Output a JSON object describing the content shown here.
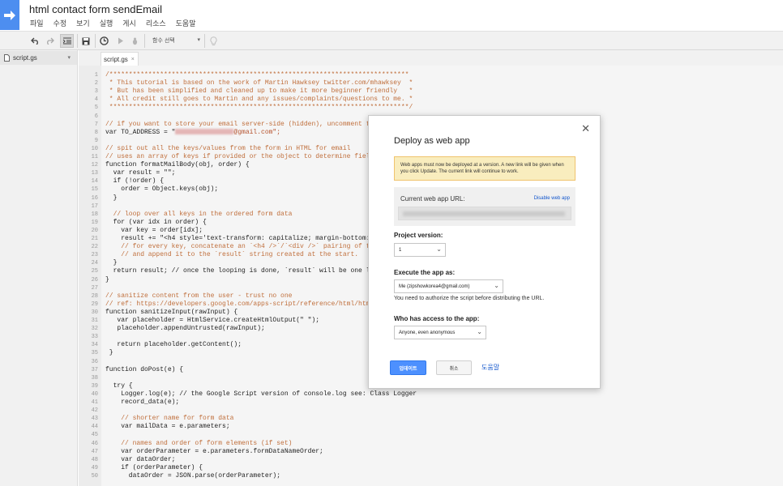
{
  "app": {
    "title": "html contact form sendEmail",
    "menu": [
      "파일",
      "수정",
      "보기",
      "실행",
      "게시",
      "리소스",
      "도움말"
    ]
  },
  "toolbar": {
    "function_select": "함수 선택"
  },
  "sidebar": {
    "files": [
      {
        "name": "script.gs"
      }
    ]
  },
  "editor": {
    "tab_label": "script.gs",
    "lines": [
      {
        "n": "1",
        "code": "/*****************************************************************************",
        "cls": "cmt"
      },
      {
        "n": "2",
        "code": " * This tutorial is based on the work of Martin Hawksey twitter.com/mhawksey  *",
        "cls": "cmt"
      },
      {
        "n": "3",
        "code": " * But has been simplified and cleaned up to make it more beginner friendly   *",
        "cls": "cmt"
      },
      {
        "n": "4",
        "code": " * All credit still goes to Martin and any issues/complaints/questions to me. *",
        "cls": "cmt"
      },
      {
        "n": "5",
        "code": " *****************************************************************************/",
        "cls": "cmt"
      },
      {
        "n": "6",
        "code": "",
        "cls": ""
      },
      {
        "n": "7",
        "code": "// if you want to store your email server-side (hidden), uncomment the",
        "cls": "cmt"
      },
      {
        "n": "8",
        "code": "var TO_ADDRESS = \"",
        "cls": "",
        "redacted_suffix": "@gmail.com\";"
      },
      {
        "n": "9",
        "code": "",
        "cls": ""
      },
      {
        "n": "10",
        "code": "// spit out all the keys/values from the form in HTML for email",
        "cls": "cmt"
      },
      {
        "n": "11",
        "code": "// uses an array of keys if provided or the object to determine field",
        "cls": "cmt"
      },
      {
        "n": "12",
        "code": "function formatMailBody(obj, order) {",
        "cls": ""
      },
      {
        "n": "13",
        "code": "  var result = \"\";",
        "cls": ""
      },
      {
        "n": "14",
        "code": "  if (!order) {",
        "cls": ""
      },
      {
        "n": "15",
        "code": "    order = Object.keys(obj);",
        "cls": ""
      },
      {
        "n": "16",
        "code": "  }",
        "cls": ""
      },
      {
        "n": "17",
        "code": "",
        "cls": ""
      },
      {
        "n": "18",
        "code": "  // loop over all keys in the ordered form data",
        "cls": "cmt"
      },
      {
        "n": "19",
        "code": "  for (var idx in order) {",
        "cls": ""
      },
      {
        "n": "20",
        "code": "    var key = order[idx];",
        "cls": ""
      },
      {
        "n": "21",
        "code": "    result += \"<h4 style='text-transform: capitalize; margin-bottom: 0",
        "cls": ""
      },
      {
        "n": "22",
        "code": "    // for every key, concatenate an `<h4 />`/`<div />` pairing of the",
        "cls": "cmt"
      },
      {
        "n": "23",
        "code": "    // and append it to the `result` string created at the start.",
        "cls": "cmt"
      },
      {
        "n": "24",
        "code": "  }",
        "cls": ""
      },
      {
        "n": "25",
        "code": "  return result; // once the looping is done, `result` will be one lon",
        "cls": ""
      },
      {
        "n": "26",
        "code": "}",
        "cls": ""
      },
      {
        "n": "27",
        "code": "",
        "cls": ""
      },
      {
        "n": "28",
        "code": "// sanitize content from the user - trust no one",
        "cls": "cmt"
      },
      {
        "n": "29",
        "code": "// ref: https://developers.google.com/apps-script/reference/html/html-",
        "cls": "cmt"
      },
      {
        "n": "30",
        "code": "function sanitizeInput(rawInput) {",
        "cls": ""
      },
      {
        "n": "31",
        "code": "   var placeholder = HtmlService.createHtmlOutput(\" \");",
        "cls": ""
      },
      {
        "n": "32",
        "code": "   placeholder.appendUntrusted(rawInput);",
        "cls": ""
      },
      {
        "n": "33",
        "code": "",
        "cls": ""
      },
      {
        "n": "34",
        "code": "   return placeholder.getContent();",
        "cls": ""
      },
      {
        "n": "35",
        "code": " }",
        "cls": ""
      },
      {
        "n": "36",
        "code": "",
        "cls": ""
      },
      {
        "n": "37",
        "code": "function doPost(e) {",
        "cls": ""
      },
      {
        "n": "38",
        "code": "",
        "cls": ""
      },
      {
        "n": "39",
        "code": "  try {",
        "cls": ""
      },
      {
        "n": "40",
        "code": "    Logger.log(e); // the Google Script version of console.log see: Class Logger",
        "cls": ""
      },
      {
        "n": "41",
        "code": "    record_data(e);",
        "cls": ""
      },
      {
        "n": "42",
        "code": "",
        "cls": ""
      },
      {
        "n": "43",
        "code": "    // shorter name for form data",
        "cls": "cmt"
      },
      {
        "n": "44",
        "code": "    var mailData = e.parameters;",
        "cls": ""
      },
      {
        "n": "45",
        "code": "",
        "cls": ""
      },
      {
        "n": "46",
        "code": "    // names and order of form elements (if set)",
        "cls": "cmt"
      },
      {
        "n": "47",
        "code": "    var orderParameter = e.parameters.formDataNameOrder;",
        "cls": ""
      },
      {
        "n": "48",
        "code": "    var dataOrder;",
        "cls": ""
      },
      {
        "n": "49",
        "code": "    if (orderParameter) {",
        "cls": ""
      },
      {
        "n": "50",
        "code": "      dataOrder = JSON.parse(orderParameter);",
        "cls": ""
      }
    ]
  },
  "dialog": {
    "title": "Deploy as web app",
    "warning": "Web apps must now be deployed at a version. A new link will be given when you click Update. The current link will continue to work.",
    "current_url_label": "Current web app URL:",
    "disable_link": "Disable web app",
    "project_version_label": "Project version:",
    "project_version_value": "1",
    "execute_as_label": "Execute the app as:",
    "execute_as_value": "Me (zipshowkorea4@gmail.com)",
    "authorize_note": "You need to authorize the script before distributing the URL.",
    "access_label": "Who has access to the app:",
    "access_value": "Anyone, even anonymous",
    "update_button": "업데이트",
    "cancel_button": "취소",
    "help_link": "도움말",
    "close_symbol": "✕"
  }
}
